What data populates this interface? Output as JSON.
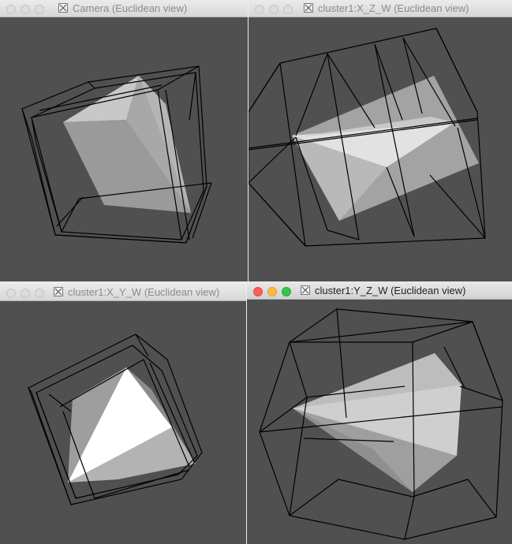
{
  "windows": [
    {
      "title": "Camera (Euclidean view)",
      "active": false
    },
    {
      "title": "cluster1:X_Z_W (Euclidean view)",
      "active": false
    },
    {
      "title": "cluster1:X_Y_W (Euclidean view)",
      "active": false
    },
    {
      "title": "cluster1:Y_Z_W (Euclidean view)",
      "active": true
    }
  ],
  "colors": {
    "viewport_bg": "#505050",
    "wireframe": "#000000",
    "close_active": "#fc605c",
    "minimize_active": "#fdbc40",
    "maximize_active": "#34c84a"
  },
  "icons": {
    "app_icon": "x11-icon"
  }
}
